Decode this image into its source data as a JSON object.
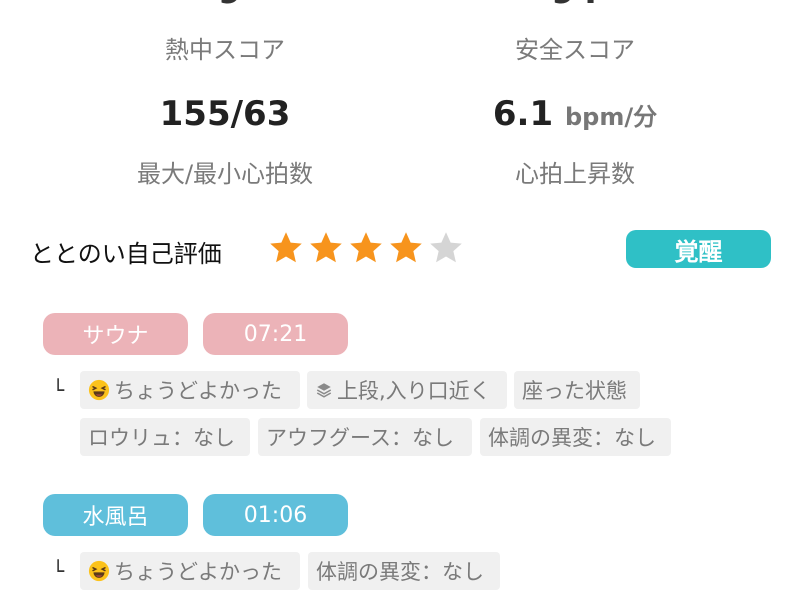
{
  "top_cut": {
    "left": "9",
    "right": "94"
  },
  "scores": {
    "heat_label": "熱中スコア",
    "safety_label": "安全スコア",
    "maxmin_value": "155/63",
    "maxmin_label": "最大/最小心拍数",
    "rise_value": "6.1",
    "rise_unit": "bpm/分",
    "rise_label": "心拍上昇数"
  },
  "evaluation": {
    "label": "ととのい自己評価",
    "rating": 4,
    "max": 5,
    "badge": "覚醒"
  },
  "sauna": {
    "label": "サウナ",
    "time": "07:21",
    "tags": [
      "ちょうどよかった",
      "上段,入り口近く",
      "座った状態",
      "ロウリュ：なし",
      "アウフグース：なし",
      "体調の異変：なし"
    ]
  },
  "water": {
    "label": "水風呂",
    "time": "01:06",
    "tags": [
      "ちょうどよかった",
      "体調の異変：なし"
    ]
  },
  "branch_symbol": "└",
  "colors": {
    "star_on": "#f7941d",
    "star_off": "#d5d5d5",
    "badge": "#2fc0c6",
    "sauna": "#ecb3b8",
    "water": "#5fbfdb"
  },
  "icons": {
    "mood": "laughing-emoji-icon",
    "position": "layers-icon"
  }
}
